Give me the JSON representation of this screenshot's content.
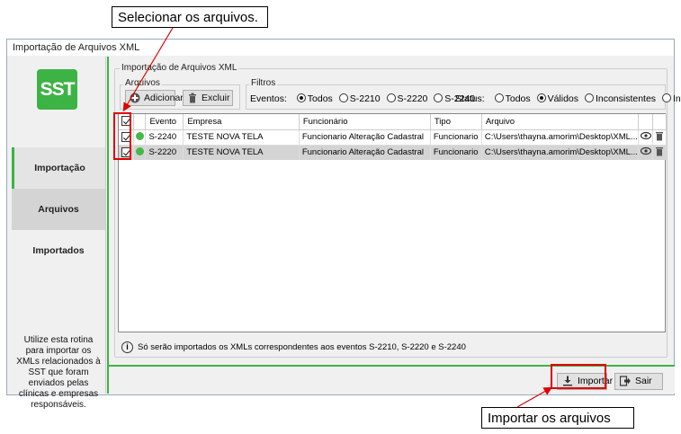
{
  "window": {
    "title": "Importação de Arquivos XML"
  },
  "logo": {
    "text": "SST",
    "color": "#3db346"
  },
  "sidebar": {
    "items": [
      {
        "label": "Importação"
      },
      {
        "label": "Arquivos Importados"
      }
    ],
    "help_text": "Utilize esta rotina para importar os XMLs relacionados à SST que foram enviados pelas clínicas e empresas responsáveis."
  },
  "main": {
    "group_title": "Importação de Arquivos XML",
    "arquivos": {
      "legend": "Arquivos",
      "add_label": "Adicionar",
      "delete_label": "Excluir"
    },
    "filtros": {
      "legend": "Filtros",
      "eventos_label": "Eventos:",
      "eventos_options": [
        "Todos",
        "S-2210",
        "S-2220",
        "S-2240"
      ],
      "eventos_selected": "Todos",
      "status_label": "Status:",
      "status_options": [
        "Todos",
        "Válidos",
        "Inconsistentes",
        "Inválidos"
      ],
      "status_selected": "Válidos"
    },
    "table": {
      "columns": [
        "Evento",
        "Empresa",
        "Funcionário",
        "Tipo",
        "Arquivo"
      ],
      "rows": [
        {
          "checked": true,
          "status_color": "#46b84a",
          "evento": "S-2240",
          "empresa": "TESTE NOVA TELA",
          "funcionario": "Funcionario Alteração Cadastral",
          "tipo": "Funcionario",
          "arquivo": "C:\\Users\\thayna.amorim\\Desktop\\XML..."
        },
        {
          "checked": true,
          "status_color": "#46b84a",
          "evento": "S-2220",
          "empresa": "TESTE NOVA TELA",
          "funcionario": "Funcionario Alteração Cadastral",
          "tipo": "Funcionario",
          "arquivo": "C:\\Users\\thayna.amorim\\Desktop\\XML..."
        }
      ]
    },
    "info_text": "Só serão importados os XMLs correspondentes aos eventos S-2210, S-2220 e S-2240"
  },
  "footer": {
    "import_label": "Importar",
    "exit_label": "Sair"
  },
  "callouts": {
    "top": "Selecionar os arquivos.",
    "bottom": "Importar os arquivos"
  },
  "colors": {
    "accent": "#3db346",
    "highlight": "#e00000"
  }
}
